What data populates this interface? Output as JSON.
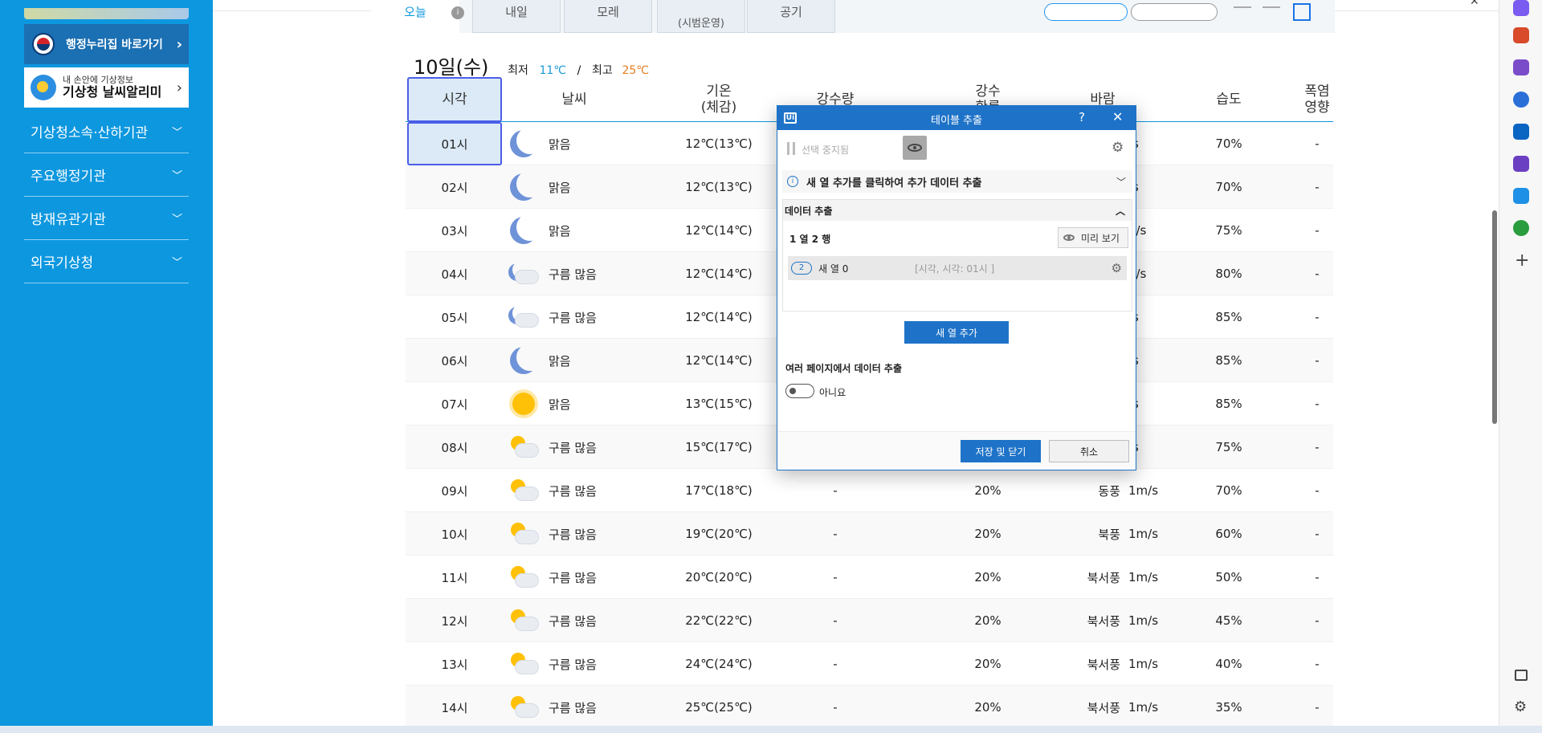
{
  "sidebar": {
    "gov_link": "행정누리집 바로가기",
    "weather_banner": {
      "small": "내 손안에 기상정보",
      "big": "기상청 날씨알리미"
    },
    "menu": [
      "기상청소속·산하기관",
      "주요행정기관",
      "방재유관기관",
      "외국기상청"
    ]
  },
  "tabs": [
    {
      "label": "오늘"
    },
    {
      "label": "내일"
    },
    {
      "label": "모레"
    },
    {
      "label": "(시범운영)"
    },
    {
      "label": "공기"
    }
  ],
  "day": {
    "title": "10일(수)",
    "min_label": "최저",
    "min": "11℃",
    "max_label": "최고",
    "max": "25℃",
    "sep": "/"
  },
  "headers": {
    "time": "시각",
    "weather": "날씨",
    "temp": "기온\n(체감)",
    "precip": "강수량",
    "prob": "강수\n확률",
    "wind": "바람",
    "humidity": "습도",
    "heat": "폭염\n영향"
  },
  "rows": [
    {
      "time": "01시",
      "icon": "moon-icon",
      "cond": "맑음",
      "temp": "12℃(13℃)",
      "precip": "",
      "prob": "",
      "wdir": "",
      "wspd": "/s",
      "hum": "70%",
      "heat": "-"
    },
    {
      "time": "02시",
      "icon": "moon-icon",
      "cond": "맑음",
      "temp": "12℃(13℃)",
      "precip": "",
      "prob": "",
      "wdir": "",
      "wspd": "/s",
      "hum": "70%",
      "heat": "-"
    },
    {
      "time": "03시",
      "icon": "moon-icon",
      "cond": "맑음",
      "temp": "12℃(14℃)",
      "precip": "",
      "prob": "",
      "wdir": "",
      "wspd": "n/s",
      "hum": "75%",
      "heat": "-"
    },
    {
      "time": "04시",
      "icon": "moon-cloud-icon",
      "cond": "구름 많음",
      "temp": "12℃(14℃)",
      "precip": "",
      "prob": "",
      "wdir": "",
      "wspd": "n/s",
      "hum": "80%",
      "heat": "-"
    },
    {
      "time": "05시",
      "icon": "moon-cloud-icon",
      "cond": "구름 많음",
      "temp": "12℃(14℃)",
      "precip": "",
      "prob": "",
      "wdir": "",
      "wspd": "/s",
      "hum": "85%",
      "heat": "-"
    },
    {
      "time": "06시",
      "icon": "moon-icon",
      "cond": "맑음",
      "temp": "12℃(14℃)",
      "precip": "",
      "prob": "",
      "wdir": "",
      "wspd": "/s",
      "hum": "85%",
      "heat": "-"
    },
    {
      "time": "07시",
      "icon": "sun-icon",
      "cond": "맑음",
      "temp": "13℃(15℃)",
      "precip": "",
      "prob": "",
      "wdir": "",
      "wspd": "/s",
      "hum": "85%",
      "heat": "-"
    },
    {
      "time": "08시",
      "icon": "sun-cloud-icon",
      "cond": "구름 많음",
      "temp": "15℃(17℃)",
      "precip": "",
      "prob": "",
      "wdir": "",
      "wspd": "/s",
      "hum": "75%",
      "heat": "-"
    },
    {
      "time": "09시",
      "icon": "sun-cloud-icon",
      "cond": "구름 많음",
      "temp": "17℃(18℃)",
      "precip": "-",
      "prob": "20%",
      "wdir": "동풍",
      "wspd": "1m/s",
      "hum": "70%",
      "heat": "-"
    },
    {
      "time": "10시",
      "icon": "sun-cloud-icon",
      "cond": "구름 많음",
      "temp": "19℃(20℃)",
      "precip": "-",
      "prob": "20%",
      "wdir": "북풍",
      "wspd": "1m/s",
      "hum": "60%",
      "heat": "-"
    },
    {
      "time": "11시",
      "icon": "sun-cloud-icon",
      "cond": "구름 많음",
      "temp": "20℃(20℃)",
      "precip": "-",
      "prob": "20%",
      "wdir": "북서풍",
      "wspd": "1m/s",
      "hum": "50%",
      "heat": "-"
    },
    {
      "time": "12시",
      "icon": "sun-cloud-icon",
      "cond": "구름 많음",
      "temp": "22℃(22℃)",
      "precip": "-",
      "prob": "20%",
      "wdir": "북서풍",
      "wspd": "1m/s",
      "hum": "45%",
      "heat": "-"
    },
    {
      "time": "13시",
      "icon": "sun-cloud-icon",
      "cond": "구름 많음",
      "temp": "24℃(24℃)",
      "precip": "-",
      "prob": "20%",
      "wdir": "북서풍",
      "wspd": "1m/s",
      "hum": "40%",
      "heat": "-"
    },
    {
      "time": "14시",
      "icon": "sun-cloud-icon",
      "cond": "구름 많음",
      "temp": "25℃(25℃)",
      "precip": "-",
      "prob": "20%",
      "wdir": "북서풍",
      "wspd": "1m/s",
      "hum": "35%",
      "heat": "-"
    }
  ],
  "dialog": {
    "title": "테이블 추출",
    "logo": "Ui",
    "help": "?",
    "close": "✕",
    "paused": "선택 중지됨",
    "info": "새 열 추가를 클릭하여 추가 데이터 추출",
    "section_title": "데이터 추출",
    "counts": "1 열  2 행",
    "preview": "미리 보기",
    "column": {
      "badge": "2",
      "name": "새 열 0",
      "sample": "[시각, 시각: 01시      ]"
    },
    "add_column": "새 열 추가",
    "multi_page": "여러 페이지에서 데이터 추출",
    "toggle_label": "아니요",
    "save": "저장 및 닫기",
    "cancel": "취소"
  }
}
